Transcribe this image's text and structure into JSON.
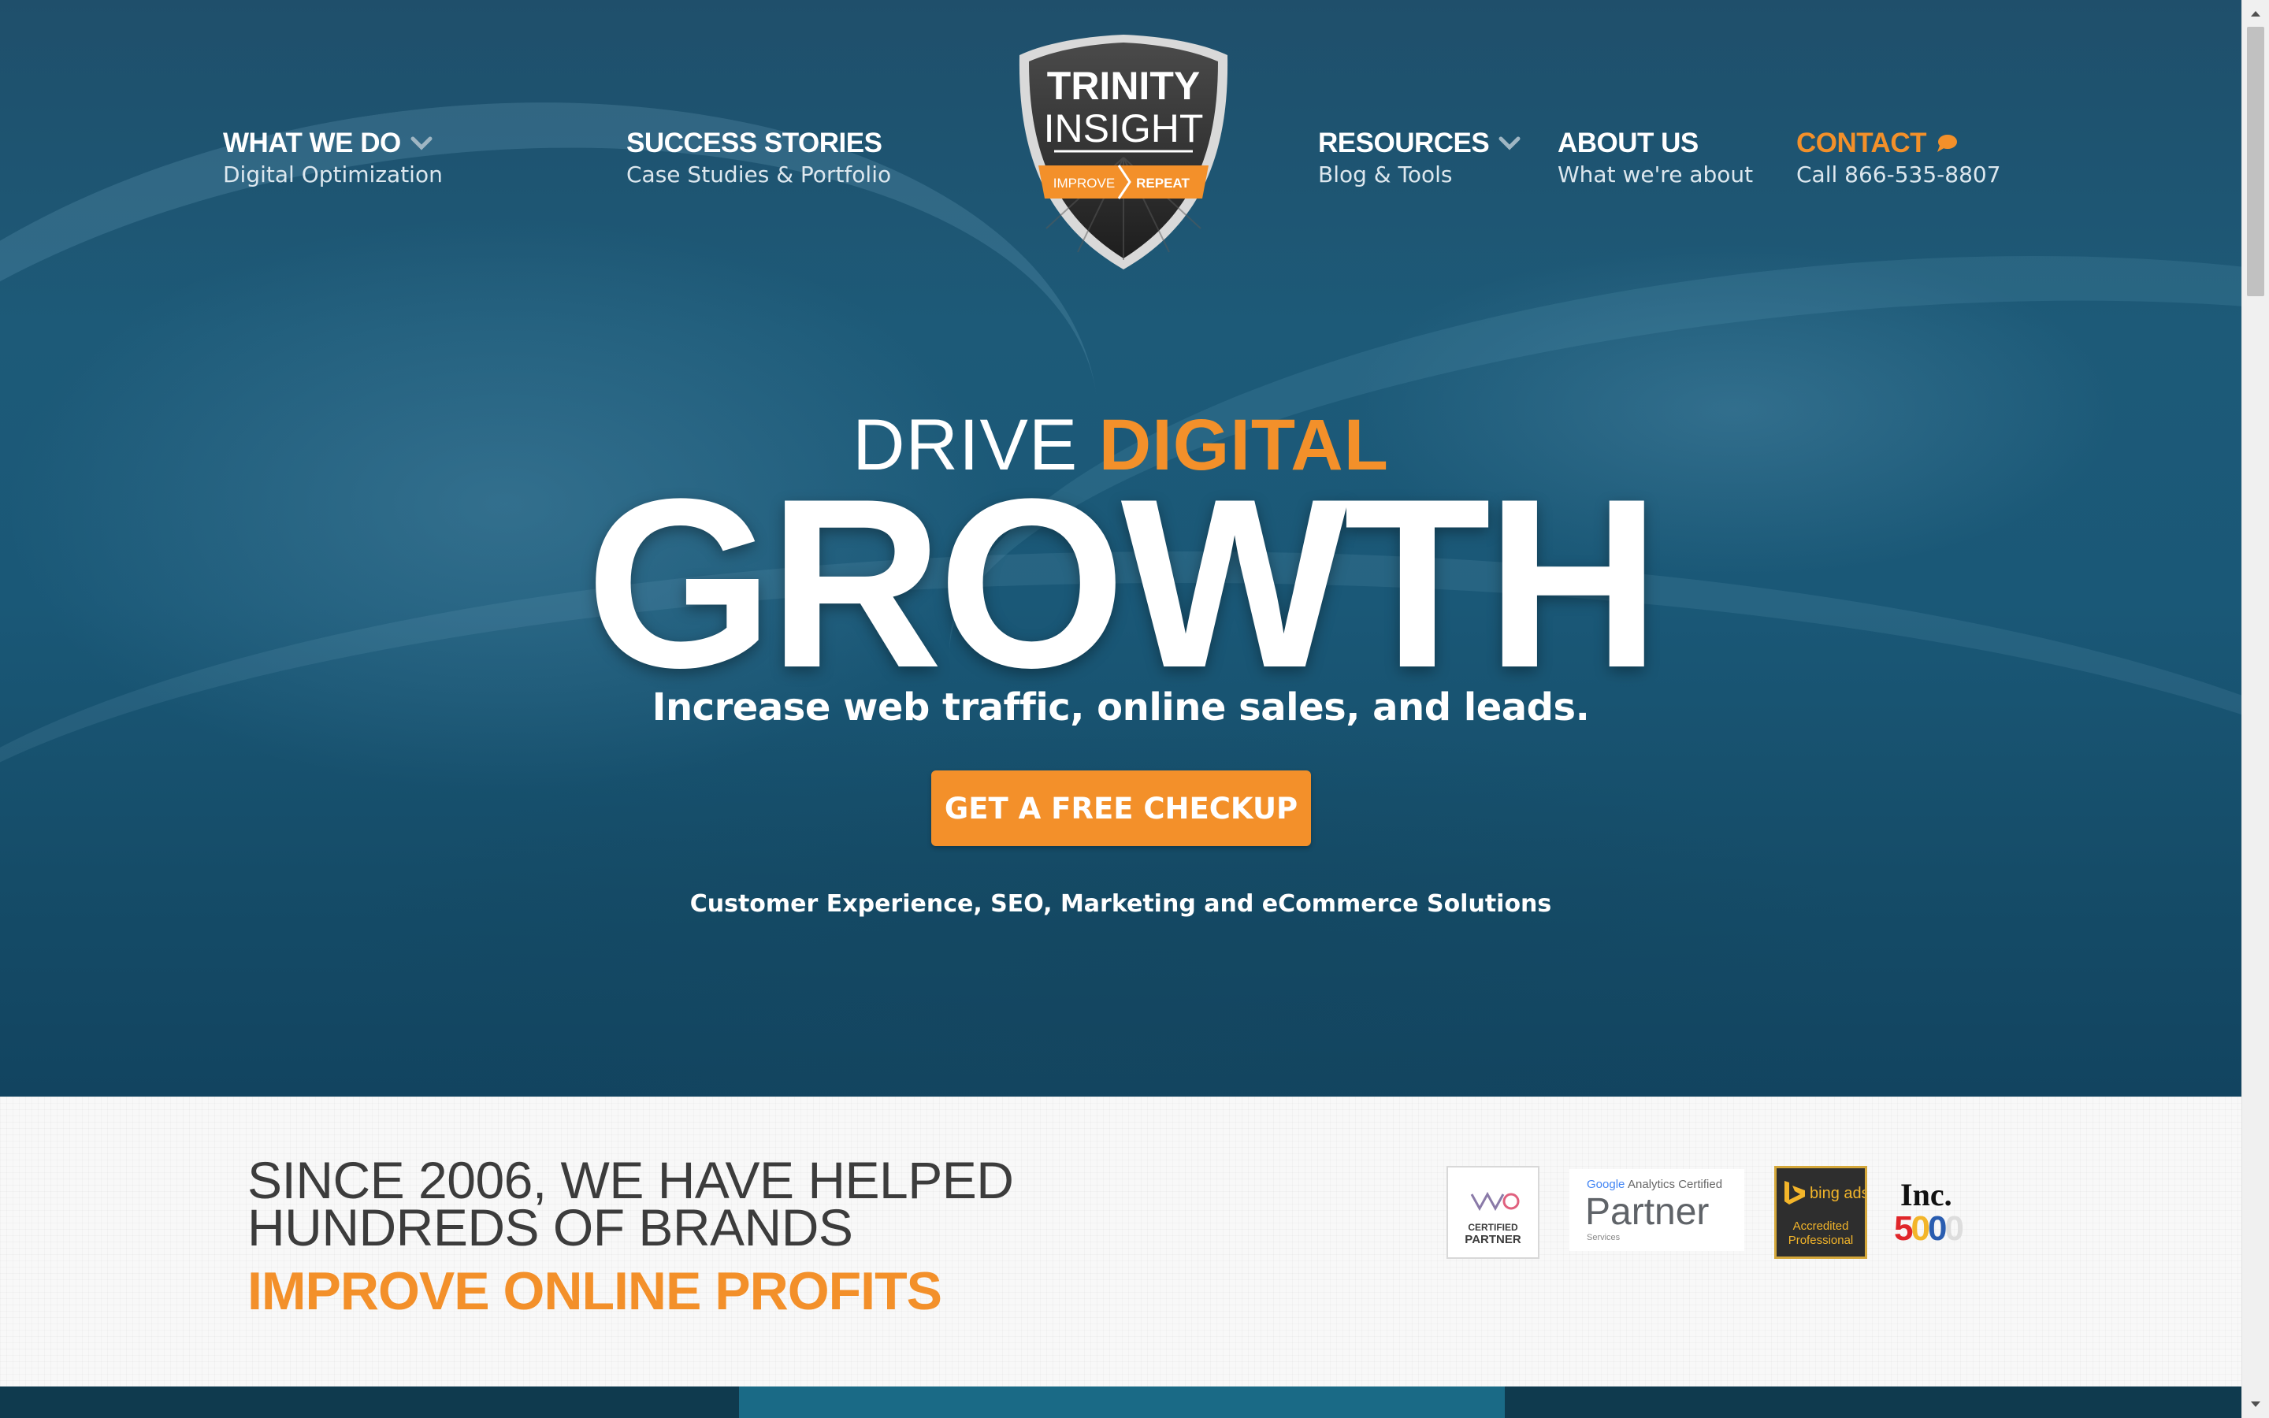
{
  "nav": {
    "what_we_do": {
      "title": "WHAT WE DO",
      "sub": "Digital Optimization"
    },
    "success_stories": {
      "title": "SUCCESS STORIES",
      "sub": "Case Studies & Portfolio"
    },
    "resources": {
      "title": "RESOURCES",
      "sub": "Blog & Tools"
    },
    "about_us": {
      "title": "ABOUT US",
      "sub": "What we're about"
    },
    "contact": {
      "title": "CONTACT",
      "sub": "Call 866-535-8807"
    }
  },
  "logo": {
    "line1": "TRINITY",
    "line2": "INSIGHT",
    "left_word": "IMPROVE",
    "right_word": "REPEAT"
  },
  "hero": {
    "drive": "DRIVE",
    "digital": "DIGITAL",
    "growth": "GROWTH",
    "subheading": "Increase web traffic, online sales, and leads.",
    "cta_label": "GET A FREE CHECKUP",
    "tagline": "Customer Experience, SEO, Marketing and eCommerce Solutions"
  },
  "section": {
    "since_line1": "SINCE 2006, WE HAVE HELPED",
    "since_line2": "HUNDREDS OF BRANDS",
    "improve": "IMPROVE ONLINE PROFITS"
  },
  "badges": {
    "vwo": {
      "line1": "CERTIFIED",
      "line2": "PARTNER"
    },
    "google": {
      "top_google": "Google",
      "top_rest": " Analytics Certified",
      "main": "Partner",
      "small": "Services"
    },
    "bing": {
      "brand": "bing ads",
      "line1": "Accredited",
      "line2": "Professional"
    },
    "inc": {
      "word": "Inc.",
      "num": "5000"
    }
  },
  "colors": {
    "accent": "#f3902a",
    "hero_bg": "#1d5a78",
    "text_dark": "#3c3c3c"
  }
}
